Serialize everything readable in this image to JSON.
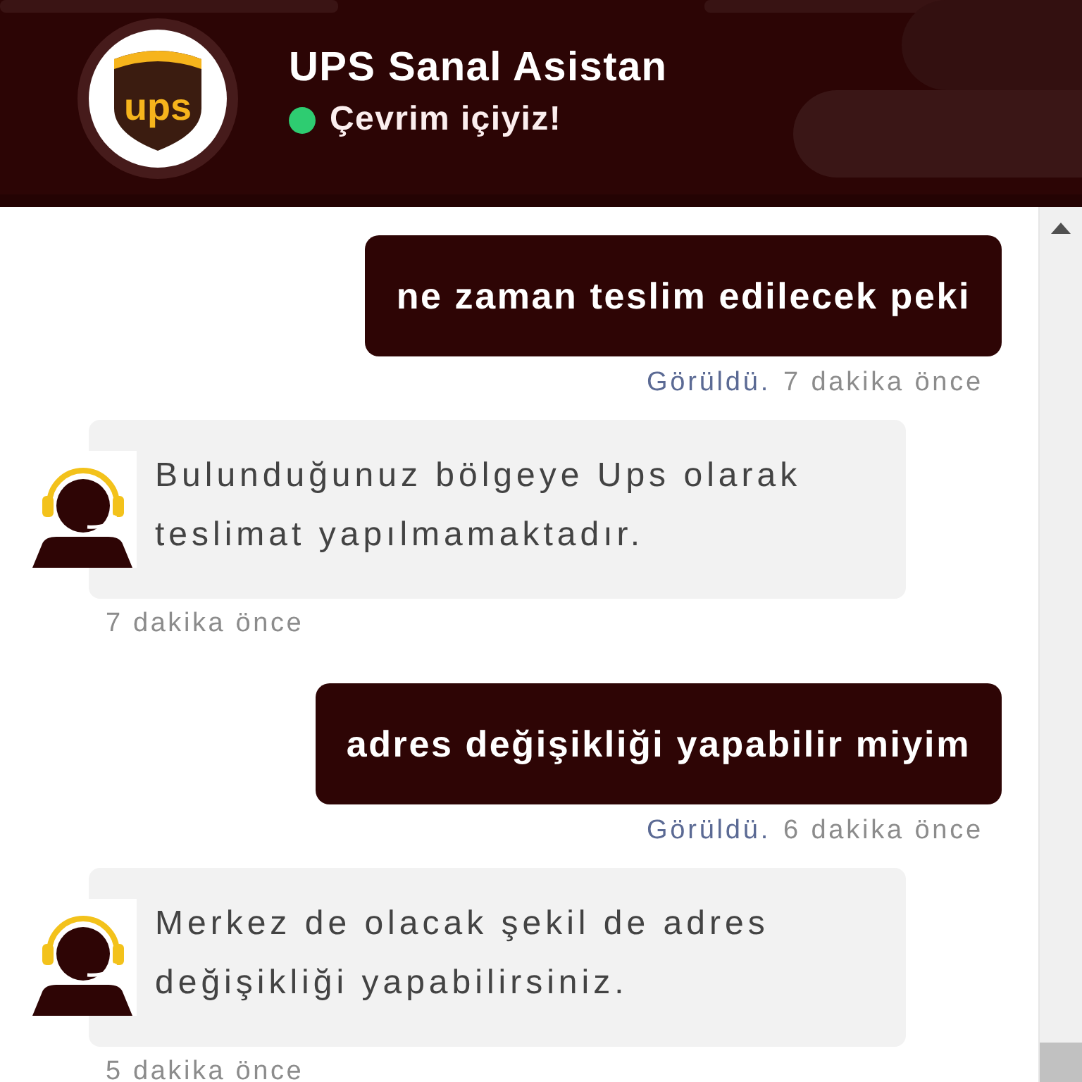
{
  "header": {
    "logo_text": "ups",
    "title": "UPS Sanal Asistan",
    "status": {
      "online": true,
      "label": "Çevrim içiyiz!"
    }
  },
  "messages": [
    {
      "kind": "user",
      "text": "ne zaman teslim edilecek peki",
      "seen_label": "Görüldü.",
      "time": "7 dakika önce"
    },
    {
      "kind": "bot",
      "text": "Bulunduğunuz bölgeye Ups olarak teslimat yapılmamaktadır.",
      "time": "7 dakika önce"
    },
    {
      "kind": "user",
      "text": "adres değişikliği yapabilir miyim",
      "seen_label": "Görüldü.",
      "time": "6 dakika önce"
    },
    {
      "kind": "bot",
      "text": "Merkez de olacak şekil de adres değişikliği yapabilirsiniz.",
      "time": "5 dakika önce"
    }
  ]
}
